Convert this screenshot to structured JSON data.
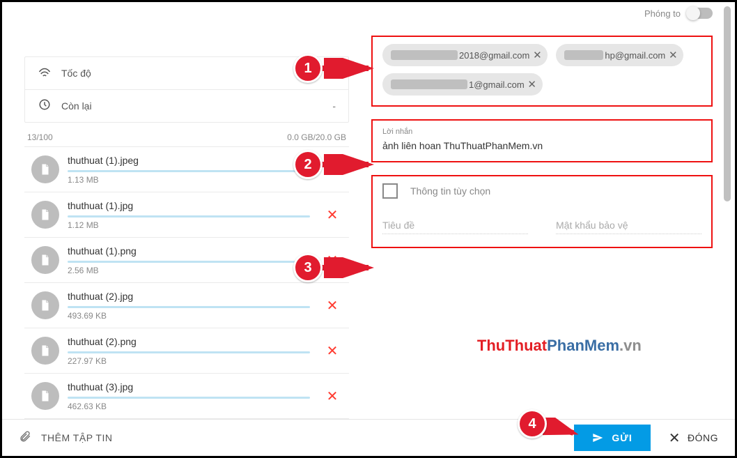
{
  "zoom": {
    "label": "Phóng to"
  },
  "left": {
    "info": {
      "speed_label": "Tốc độ",
      "speed_value": "-",
      "remaining_label": "Còn lại",
      "remaining_value": "-"
    },
    "counter": "13/100",
    "quota": "0.0 GB/20.0 GB",
    "files": [
      {
        "name": "thuthuat (1).jpeg",
        "size": "1.13 MB"
      },
      {
        "name": "thuthuat (1).jpg",
        "size": "1.12 MB"
      },
      {
        "name": "thuthuat (1).png",
        "size": "2.56 MB"
      },
      {
        "name": "thuthuat (2).jpg",
        "size": "493.69 KB"
      },
      {
        "name": "thuthuat (2).png",
        "size": "227.97 KB"
      },
      {
        "name": "thuthuat (3).jpg",
        "size": "462.63 KB"
      }
    ]
  },
  "right": {
    "recipients": [
      {
        "suffix": "2018@gmail.com"
      },
      {
        "suffix": "hp@gmail.com"
      },
      {
        "suffix": "1@gmail.com"
      }
    ],
    "message": {
      "label": "Lời nhắn",
      "text": "ảnh liên hoan ThuThuatPhanMem.vn"
    },
    "optional": {
      "label": "Thông tin tùy chọn",
      "title_placeholder": "Tiêu đề",
      "password_placeholder": "Mật khẩu bảo vệ"
    },
    "watermark": {
      "a": "ThuThuat",
      "b": "PhanMem",
      "c": ".vn"
    }
  },
  "footer": {
    "attach": "THÊM TẬP TIN",
    "send": "GỬI",
    "close": "ĐÓNG"
  },
  "annotations": [
    "1",
    "2",
    "3",
    "4"
  ]
}
